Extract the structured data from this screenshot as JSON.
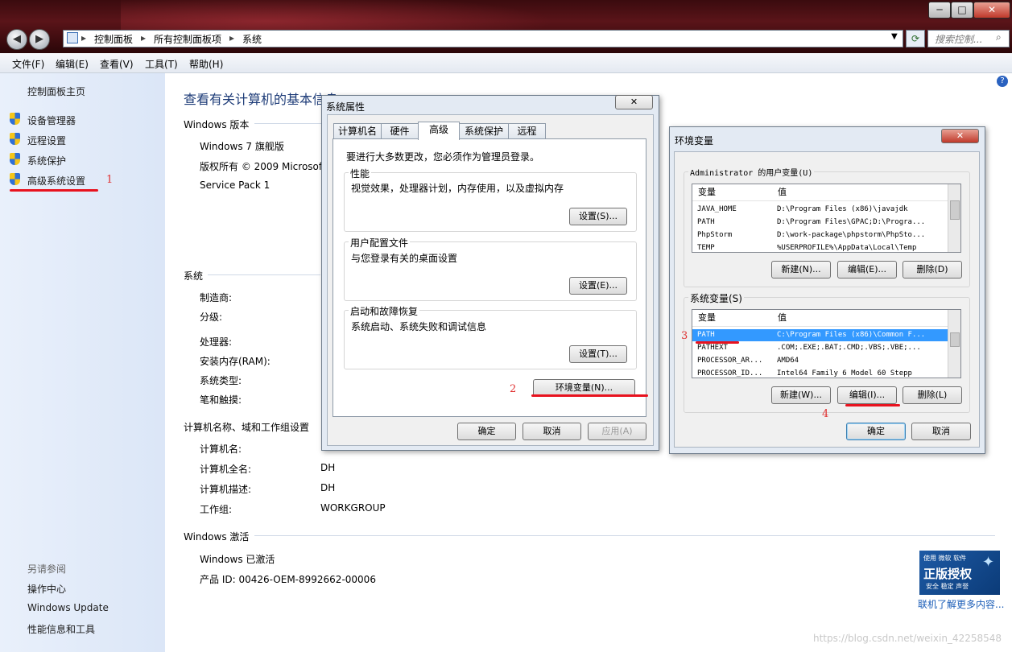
{
  "window": {
    "min_glyph": "─",
    "max_glyph": "□",
    "close_glyph": "✕",
    "back_glyph": "◀",
    "forward_glyph": "▶"
  },
  "address": {
    "crumbs": [
      "控制面板",
      "所有控制面板项",
      "系统"
    ],
    "search_placeholder": "搜索控制..."
  },
  "menu": [
    "文件(F)",
    "编辑(E)",
    "查看(V)",
    "工具(T)",
    "帮助(H)"
  ],
  "sidebar": {
    "home": "控制面板主页",
    "items": [
      "设备管理器",
      "远程设置",
      "系统保护",
      "高级系统设置"
    ],
    "see_also_title": "另请参阅",
    "see_also": [
      "操作中心",
      "Windows Update",
      "性能信息和工具"
    ]
  },
  "main": {
    "title": "查看有关计算机的基本信息",
    "edition_header": "Windows 版本",
    "edition": "Windows 7 旗舰版",
    "copyright": "版权所有 © 2009 Microsof",
    "service_pack": "Service Pack 1",
    "system_header": "系统",
    "system_labels": [
      "制造商:",
      "分级:",
      "处理器:",
      "安装内存(RAM):",
      "系统类型:",
      "笔和触摸:"
    ],
    "computer_header": "计算机名称、域和工作组设置",
    "computer_labels": [
      "计算机名:",
      "计算机全名:",
      "计算机描述:",
      "工作组:"
    ],
    "computer_values": [
      "DH",
      "DH",
      "DH",
      "WORKGROUP"
    ],
    "activation_header": "Windows 激活",
    "activation_status": "Windows 已激活",
    "product_id": "产品 ID: 00426-OEM-8992662-00006",
    "genuine_link": "联机了解更多内容...",
    "genuine_badge": {
      "line1": "使用 微软 软件",
      "line2": "正版授权",
      "line3": "安全 稳定 声誉"
    }
  },
  "sysprops": {
    "title": "系统属性",
    "close_glyph": "✕",
    "tabs": [
      "计算机名",
      "硬件",
      "高级",
      "系统保护",
      "远程"
    ],
    "admin_note": "要进行大多数更改，您必须作为管理员登录。",
    "groups": [
      {
        "title": "性能",
        "desc": "视觉效果，处理器计划，内存使用，以及虚拟内存",
        "button": "设置(S)..."
      },
      {
        "title": "用户配置文件",
        "desc": "与您登录有关的桌面设置",
        "button": "设置(E)..."
      },
      {
        "title": "启动和故障恢复",
        "desc": "系统启动、系统失败和调试信息",
        "button": "设置(T)..."
      }
    ],
    "env_button": "环境变量(N)...",
    "ok": "确定",
    "cancel": "取消",
    "apply": "应用(A)"
  },
  "envvars": {
    "title": "环境变量",
    "close_glyph": "✕",
    "user_group": "Administrator 的用户变量(U)",
    "col_var": "变量",
    "col_val": "值",
    "user_rows": [
      {
        "var": "JAVA_HOME",
        "val": "D:\\Program Files (x86)\\javajdk"
      },
      {
        "var": "PATH",
        "val": "D:\\Program Files\\GPAC;D:\\Progra..."
      },
      {
        "var": "PhpStorm",
        "val": "D:\\work-package\\phpstorm\\PhpSto..."
      },
      {
        "var": "TEMP",
        "val": "%USERPROFILE%\\AppData\\Local\\Temp"
      }
    ],
    "user_buttons": [
      "新建(N)...",
      "编辑(E)...",
      "删除(D)"
    ],
    "sys_group": "系统变量(S)",
    "sys_rows": [
      {
        "var": "PATH",
        "val": "C:\\Program Files (x86)\\Common F..."
      },
      {
        "var": "PATHEXT",
        "val": ".COM;.EXE;.BAT;.CMD;.VBS;.VBE;..."
      },
      {
        "var": "PROCESSOR_AR...",
        "val": "AMD64"
      },
      {
        "var": "PROCESSOR_ID...",
        "val": "Intel64 Family 6 Model 60 Stepp"
      }
    ],
    "sys_buttons": [
      "新建(W)...",
      "编辑(I)...",
      "删除(L)"
    ],
    "ok": "确定",
    "cancel": "取消"
  },
  "annotations": [
    "1",
    "2",
    "3",
    "4"
  ],
  "watermark": "https://blog.csdn.net/weixin_42258548",
  "colors": {
    "annotation_red": "#e8121e",
    "link_blue": "#1c5eb8",
    "selected_row": "#3399ff"
  }
}
